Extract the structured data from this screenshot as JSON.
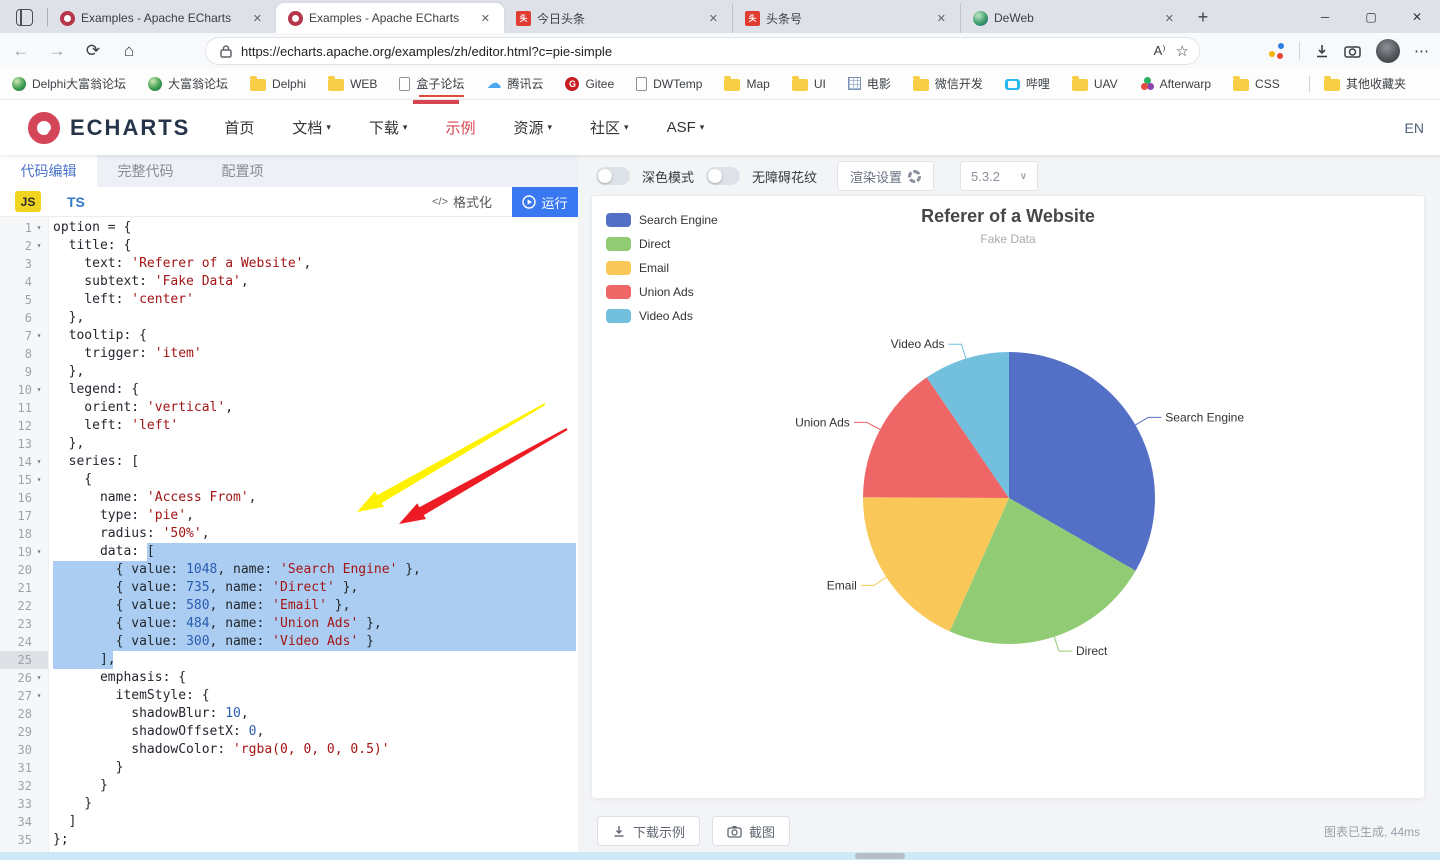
{
  "browser": {
    "tabs": [
      {
        "title": "Examples - Apache ECharts",
        "favicon": "echarts",
        "active": false
      },
      {
        "title": "Examples - Apache ECharts",
        "favicon": "echarts",
        "active": true
      },
      {
        "title": "今日头条",
        "favicon": "toutiao",
        "active": false
      },
      {
        "title": "头条号",
        "favicon": "toutiao",
        "active": false
      },
      {
        "title": "DeWeb",
        "favicon": "globe",
        "active": false
      }
    ],
    "url": "https://echarts.apache.org/examples/zh/editor.html?c=pie-simple",
    "bookmarks": [
      {
        "label": "Delphi大富翁论坛",
        "icon": "globe"
      },
      {
        "label": "大富翁论坛",
        "icon": "globe"
      },
      {
        "label": "Delphi",
        "icon": "folder"
      },
      {
        "label": "WEB",
        "icon": "folder"
      },
      {
        "label": "盒子论坛",
        "icon": "page",
        "highlighted": true
      },
      {
        "label": "腾讯云",
        "icon": "cloud"
      },
      {
        "label": "Gitee",
        "icon": "gitee"
      },
      {
        "label": "DWTemp",
        "icon": "page"
      },
      {
        "label": "Map",
        "icon": "folder"
      },
      {
        "label": "UI",
        "icon": "folder"
      },
      {
        "label": "电影",
        "icon": "grid"
      },
      {
        "label": "微信开发",
        "icon": "folder"
      },
      {
        "label": "哔哩",
        "icon": "tv"
      },
      {
        "label": "UAV",
        "icon": "folder"
      },
      {
        "label": "Afterwarp",
        "icon": "shapes"
      },
      {
        "label": "CSS",
        "icon": "folder"
      }
    ],
    "other_bookmarks": "其他收藏夹"
  },
  "site_header": {
    "brand": "ECHARTS",
    "nav": [
      {
        "label": "首页",
        "caret": false,
        "active": false
      },
      {
        "label": "文档",
        "caret": true,
        "active": false
      },
      {
        "label": "下载",
        "caret": true,
        "active": false
      },
      {
        "label": "示例",
        "caret": false,
        "active": true
      },
      {
        "label": "资源",
        "caret": true,
        "active": false
      },
      {
        "label": "社区",
        "caret": true,
        "active": false
      },
      {
        "label": "ASF",
        "caret": true,
        "active": false
      }
    ],
    "lang": "EN"
  },
  "editor": {
    "tabs": [
      {
        "label": "代码编辑",
        "active": true
      },
      {
        "label": "完整代码",
        "active": false
      },
      {
        "label": "配置项",
        "active": false
      }
    ],
    "js_label": "JS",
    "ts_label": "TS",
    "format_label": "格式化",
    "run_label": "运行",
    "lines": [
      {
        "n": 1,
        "fold": true,
        "tokens": [
          [
            "p",
            "option = {"
          ]
        ]
      },
      {
        "n": 2,
        "fold": true,
        "tokens": [
          [
            "p",
            "  title: {"
          ]
        ]
      },
      {
        "n": 3,
        "fold": false,
        "tokens": [
          [
            "p",
            "    text: "
          ],
          [
            "s",
            "'Referer of a Website'"
          ],
          [
            "p",
            ","
          ]
        ]
      },
      {
        "n": 4,
        "fold": false,
        "tokens": [
          [
            "p",
            "    subtext: "
          ],
          [
            "s",
            "'Fake Data'"
          ],
          [
            "p",
            ","
          ]
        ]
      },
      {
        "n": 5,
        "fold": false,
        "tokens": [
          [
            "p",
            "    left: "
          ],
          [
            "s",
            "'center'"
          ]
        ]
      },
      {
        "n": 6,
        "fold": false,
        "tokens": [
          [
            "p",
            "  },"
          ]
        ]
      },
      {
        "n": 7,
        "fold": true,
        "tokens": [
          [
            "p",
            "  tooltip: {"
          ]
        ]
      },
      {
        "n": 8,
        "fold": false,
        "tokens": [
          [
            "p",
            "    trigger: "
          ],
          [
            "s",
            "'item'"
          ]
        ]
      },
      {
        "n": 9,
        "fold": false,
        "tokens": [
          [
            "p",
            "  },"
          ]
        ]
      },
      {
        "n": 10,
        "fold": true,
        "tokens": [
          [
            "p",
            "  legend: {"
          ]
        ]
      },
      {
        "n": 11,
        "fold": false,
        "tokens": [
          [
            "p",
            "    orient: "
          ],
          [
            "s",
            "'vertical'"
          ],
          [
            "p",
            ","
          ]
        ]
      },
      {
        "n": 12,
        "fold": false,
        "tokens": [
          [
            "p",
            "    left: "
          ],
          [
            "s",
            "'left'"
          ]
        ]
      },
      {
        "n": 13,
        "fold": false,
        "tokens": [
          [
            "p",
            "  },"
          ]
        ]
      },
      {
        "n": 14,
        "fold": true,
        "tokens": [
          [
            "p",
            "  series: ["
          ]
        ]
      },
      {
        "n": 15,
        "fold": true,
        "tokens": [
          [
            "p",
            "    {"
          ]
        ]
      },
      {
        "n": 16,
        "fold": false,
        "tokens": [
          [
            "p",
            "      name: "
          ],
          [
            "s",
            "'Access From'"
          ],
          [
            "p",
            ","
          ]
        ]
      },
      {
        "n": 17,
        "fold": false,
        "tokens": [
          [
            "p",
            "      type: "
          ],
          [
            "s",
            "'pie'"
          ],
          [
            "p",
            ","
          ]
        ]
      },
      {
        "n": 18,
        "fold": false,
        "tokens": [
          [
            "p",
            "      radius: "
          ],
          [
            "s",
            "'50%'"
          ],
          [
            "p",
            ","
          ]
        ]
      },
      {
        "n": 19,
        "fold": true,
        "tokens": [
          [
            "p",
            "      data: ["
          ]
        ]
      },
      {
        "n": 20,
        "fold": false,
        "tokens": [
          [
            "p",
            "        { value: "
          ],
          [
            "n",
            "1048"
          ],
          [
            "p",
            ", name: "
          ],
          [
            "s",
            "'Search Engine'"
          ],
          [
            "p",
            " },"
          ]
        ]
      },
      {
        "n": 21,
        "fold": false,
        "tokens": [
          [
            "p",
            "        { value: "
          ],
          [
            "n",
            "735"
          ],
          [
            "p",
            ", name: "
          ],
          [
            "s",
            "'Direct'"
          ],
          [
            "p",
            " },"
          ]
        ]
      },
      {
        "n": 22,
        "fold": false,
        "tokens": [
          [
            "p",
            "        { value: "
          ],
          [
            "n",
            "580"
          ],
          [
            "p",
            ", name: "
          ],
          [
            "s",
            "'Email'"
          ],
          [
            "p",
            " },"
          ]
        ]
      },
      {
        "n": 23,
        "fold": false,
        "tokens": [
          [
            "p",
            "        { value: "
          ],
          [
            "n",
            "484"
          ],
          [
            "p",
            ", name: "
          ],
          [
            "s",
            "'Union Ads'"
          ],
          [
            "p",
            " },"
          ]
        ]
      },
      {
        "n": 24,
        "fold": false,
        "tokens": [
          [
            "p",
            "        { value: "
          ],
          [
            "n",
            "300"
          ],
          [
            "p",
            ", name: "
          ],
          [
            "s",
            "'Video Ads'"
          ],
          [
            "p",
            " }"
          ]
        ]
      },
      {
        "n": 25,
        "fold": false,
        "active": true,
        "tokens": [
          [
            "p",
            "      ],"
          ]
        ]
      },
      {
        "n": 26,
        "fold": true,
        "tokens": [
          [
            "p",
            "      emphasis: {"
          ]
        ]
      },
      {
        "n": 27,
        "fold": true,
        "tokens": [
          [
            "p",
            "        itemStyle: {"
          ]
        ]
      },
      {
        "n": 28,
        "fold": false,
        "tokens": [
          [
            "p",
            "          shadowBlur: "
          ],
          [
            "n",
            "10"
          ],
          [
            "p",
            ","
          ]
        ]
      },
      {
        "n": 29,
        "fold": false,
        "tokens": [
          [
            "p",
            "          shadowOffsetX: "
          ],
          [
            "n",
            "0"
          ],
          [
            "p",
            ","
          ]
        ]
      },
      {
        "n": 30,
        "fold": false,
        "tokens": [
          [
            "p",
            "          shadowColor: "
          ],
          [
            "s",
            "'rgba(0, 0, 0, 0.5)'"
          ]
        ]
      },
      {
        "n": 31,
        "fold": false,
        "tokens": [
          [
            "p",
            "        }"
          ]
        ]
      },
      {
        "n": 32,
        "fold": false,
        "tokens": [
          [
            "p",
            "      }"
          ]
        ]
      },
      {
        "n": 33,
        "fold": false,
        "tokens": [
          [
            "p",
            "    }"
          ]
        ]
      },
      {
        "n": 34,
        "fold": false,
        "tokens": [
          [
            "p",
            "  ]"
          ]
        ]
      },
      {
        "n": 35,
        "fold": false,
        "tokens": [
          [
            "p",
            "};"
          ]
        ]
      }
    ]
  },
  "preview": {
    "dark_mode_label": "深色模式",
    "aria_label": "无障碍花纹",
    "render_settings_label": "渲染设置",
    "version": "5.3.2",
    "download_label": "下载示例",
    "capture_label": "截图",
    "status": "图表已生成, 44ms"
  },
  "chart_data": {
    "type": "pie",
    "title": "Referer of a Website",
    "subtitle": "Fake Data",
    "series_name": "Access From",
    "labels": [
      "Search Engine",
      "Direct",
      "Email",
      "Union Ads",
      "Video Ads"
    ],
    "values": [
      1048,
      735,
      580,
      484,
      300
    ],
    "colors": [
      "#5470c6",
      "#91cc75",
      "#fac858",
      "#ee6666",
      "#73c0de"
    ],
    "radius_pct": 50,
    "start_angle": "top",
    "direction": "clockwise",
    "legend_position": "top-left",
    "legend_orient": "vertical"
  }
}
